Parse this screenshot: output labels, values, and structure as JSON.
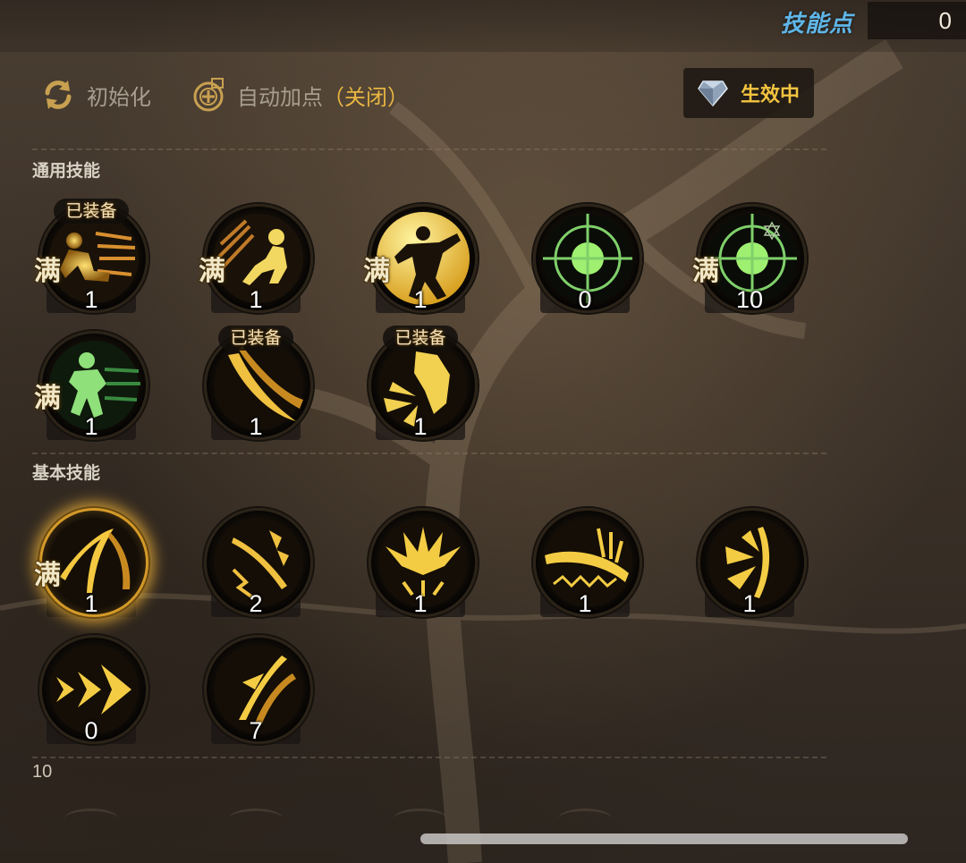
{
  "header": {
    "skill_points_label": "技能点",
    "skill_points_value": "0"
  },
  "toolbar": {
    "reset_label": "初始化",
    "auto_add_label": "自动加点",
    "auto_add_state": "（关闭）",
    "effect_label": "生效中"
  },
  "sections": {
    "general_title": "通用技能",
    "basic_title": "基本技能",
    "next_title": "10"
  },
  "general_skills": [
    {
      "icon": "dash-figure-icon",
      "level": "1",
      "max": "满",
      "equipped": "已装备"
    },
    {
      "icon": "crouch-figure-icon",
      "level": "1",
      "max": "满"
    },
    {
      "icon": "punch-figure-icon",
      "level": "1",
      "max": "满"
    },
    {
      "icon": "target-icon",
      "level": "0"
    },
    {
      "icon": "target-star-icon",
      "level": "10",
      "max": "满"
    },
    {
      "icon": "green-runner-icon",
      "level": "1",
      "max": "满"
    },
    {
      "icon": "slash-arc-icon",
      "level": "1",
      "equipped": "已装备"
    },
    {
      "icon": "spike-burst-icon",
      "level": "1",
      "equipped": "已装备"
    }
  ],
  "basic_skills": [
    {
      "icon": "arc-strike-icon",
      "level": "1",
      "max": "满"
    },
    {
      "icon": "claw-slash-icon",
      "level": "2"
    },
    {
      "icon": "flame-crown-icon",
      "level": "1"
    },
    {
      "icon": "wave-slash-icon",
      "level": "1"
    },
    {
      "icon": "cross-slash-icon",
      "level": "1"
    },
    {
      "icon": "triple-arrow-icon",
      "level": "0"
    },
    {
      "icon": "twin-blade-icon",
      "level": "7"
    }
  ],
  "colors": {
    "accent_gold": "#f3c440",
    "label_blue": "#5fb6e8",
    "muted_text": "#a79e90",
    "target_green": "#8fe36a"
  }
}
